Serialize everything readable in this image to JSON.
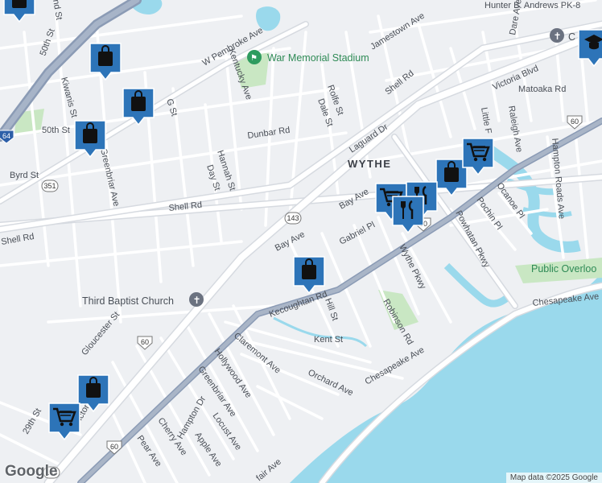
{
  "colors": {
    "land": "#eef0f3",
    "water": "#9ad9ec",
    "park": "#c9e7c3",
    "highway": "#8b9bb5",
    "road": "#ffffff",
    "marker": "#2d74b8"
  },
  "neighborhood": "WYTHE",
  "streets": {
    "w_pembroke": "W Pembroke Ave",
    "kentucky": "Kentucky Ave",
    "jamestown": "Jamestown Ave",
    "hunter": "Hunter B. Andrews PK-8",
    "victoria_top": "Victoria Blvd",
    "matoaka": "Matoaka Rd",
    "dare": "Dare Ave",
    "shell_top": "Shell Rd",
    "rolfe": "Rolfe St",
    "dale": "Dale St",
    "laguard": "Laguard Dr",
    "dunbar": "Dunbar Rd",
    "g_st": "G St",
    "hannah": "Hannah St",
    "day": "Day St",
    "st50_top": "50th St",
    "st50": "50th St",
    "kiwanis": "Kiwanis St",
    "greenbriar_left": "Greenbriar Ave",
    "byrd": "Byrd St",
    "shell_mid": "Shell Rd",
    "shell_left": "Shell Rd",
    "bay_top": "Bay Ave",
    "bay_low": "Bay Ave",
    "gabriel": "Gabriel Pl",
    "wythe_pkwy": "Wythe Pkwy",
    "powhatan": "Powhatan Pkwy",
    "pochin": "Pochin Pl",
    "ocanoe": "Ocanoe Pl",
    "little": "Little F",
    "raleigh": "Raleigh Ave",
    "hampton_roads": "Hampton Roads Ave",
    "chesapeake_r": "Chesapeake Ave",
    "chesapeake_low": "Chesapeake Ave",
    "kecoughtan": "Kecoughtan Rd",
    "hill": "Hill St",
    "robinson": "Robinson Rd",
    "kent": "Kent St",
    "orchard": "Orchard Ave",
    "claremont": "Claremont Ave",
    "hollywood": "Hollywood Ave",
    "greenbriar_low": "Greenbriar Ave",
    "hampton_dr": "Hampton Dr",
    "locust": "Locust Ave",
    "apple": "Apple Ave",
    "cherry": "Cherry Ave",
    "pear": "Pear Ave",
    "gloucester": "Gloucester St",
    "victoria_low": "S Victoria Blvd",
    "st29": "29th St",
    "nd": "nd St",
    "fair": "fair Ave"
  },
  "shields": {
    "rt351": "351",
    "rt143_a": "143",
    "rt143_b": "143",
    "rt60_a": "60",
    "rt60_b": "60",
    "rt60_c": "60",
    "rt60_d": "60",
    "i64": "64"
  },
  "poi": {
    "stadium": "War Memorial Stadium",
    "church": "Third Baptist Church",
    "overlook": "Public Overloo",
    "chapel": "C"
  },
  "markers": [
    {
      "type": "shopping",
      "label": "shopping-bag"
    },
    {
      "type": "shopping",
      "label": "shopping-bag"
    },
    {
      "type": "shopping",
      "label": "shopping-bag"
    },
    {
      "type": "shopping",
      "label": "shopping-bag"
    },
    {
      "type": "shopping",
      "label": "shopping-bag"
    },
    {
      "type": "shopping",
      "label": "shopping-bag"
    },
    {
      "type": "shopping",
      "label": "shopping-bag"
    },
    {
      "type": "cart",
      "label": "shopping-cart"
    },
    {
      "type": "cart",
      "label": "shopping-cart"
    },
    {
      "type": "cart",
      "label": "shopping-cart"
    },
    {
      "type": "restaurant",
      "label": "restaurant"
    },
    {
      "type": "restaurant",
      "label": "restaurant"
    },
    {
      "type": "school",
      "label": "school"
    }
  ],
  "attribution": "Map data ©2025 Google",
  "logo": "Google"
}
